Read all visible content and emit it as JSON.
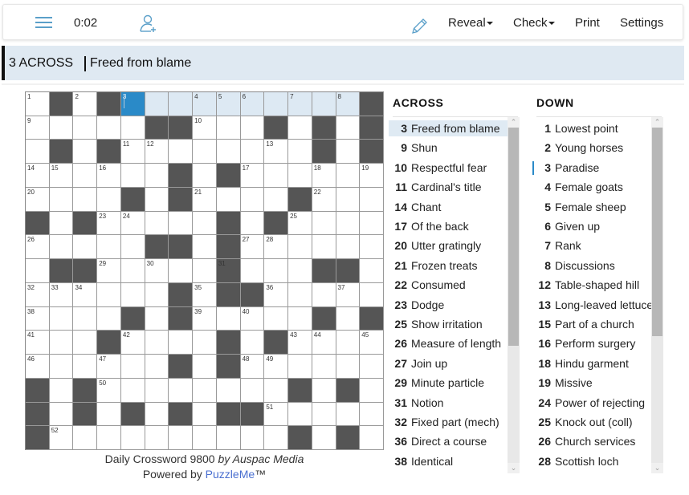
{
  "toolbar": {
    "timer": "0:02",
    "menu_icon": "hamburger-menu-icon",
    "add_user_icon": "add-user-icon",
    "pencil_icon": "pencil-icon",
    "reveal_label": "Reveal",
    "check_label": "Check",
    "print_label": "Print",
    "settings_label": "Settings",
    "accent_color": "#5a9fc9"
  },
  "current_clue": {
    "label": "3 ACROSS",
    "text": "Freed from blame"
  },
  "grid": {
    "size": 15,
    "rows": [
      ".#.#..........#",
      ".....##...#.#.#",
      ".#.#........#.#",
      "......#.#......",
      "....#.#....#...",
      "#.#.....#.#....",
      ".....##.#......",
      ".##.....#...##.",
      "......#.##.....",
      "....#.#.....#.#",
      "...#....#.#....",
      "......#.#......",
      "#.#........#.#.",
      "#.#.#.#.##.....",
      "#..........#.#."
    ],
    "numbers": [
      {
        "r": 0,
        "c": 0,
        "n": "1"
      },
      {
        "r": 0,
        "c": 2,
        "n": "2"
      },
      {
        "r": 0,
        "c": 4,
        "n": "3"
      },
      {
        "r": 0,
        "c": 7,
        "n": "4"
      },
      {
        "r": 0,
        "c": 8,
        "n": "5"
      },
      {
        "r": 0,
        "c": 9,
        "n": "6"
      },
      {
        "r": 0,
        "c": 11,
        "n": "7"
      },
      {
        "r": 0,
        "c": 13,
        "n": "8"
      },
      {
        "r": 1,
        "c": 0,
        "n": "9"
      },
      {
        "r": 1,
        "c": 7,
        "n": "10"
      },
      {
        "r": 2,
        "c": 4,
        "n": "11"
      },
      {
        "r": 2,
        "c": 5,
        "n": "12"
      },
      {
        "r": 2,
        "c": 10,
        "n": "13"
      },
      {
        "r": 3,
        "c": 0,
        "n": "14"
      },
      {
        "r": 3,
        "c": 1,
        "n": "15"
      },
      {
        "r": 3,
        "c": 3,
        "n": "16"
      },
      {
        "r": 3,
        "c": 9,
        "n": "17"
      },
      {
        "r": 3,
        "c": 12,
        "n": "18"
      },
      {
        "r": 3,
        "c": 14,
        "n": "19"
      },
      {
        "r": 4,
        "c": 0,
        "n": "20"
      },
      {
        "r": 4,
        "c": 7,
        "n": "21"
      },
      {
        "r": 4,
        "c": 12,
        "n": "22"
      },
      {
        "r": 5,
        "c": 3,
        "n": "23"
      },
      {
        "r": 5,
        "c": 4,
        "n": "24"
      },
      {
        "r": 5,
        "c": 11,
        "n": "25"
      },
      {
        "r": 6,
        "c": 0,
        "n": "26"
      },
      {
        "r": 6,
        "c": 9,
        "n": "27"
      },
      {
        "r": 6,
        "c": 10,
        "n": "28"
      },
      {
        "r": 7,
        "c": 3,
        "n": "29"
      },
      {
        "r": 7,
        "c": 5,
        "n": "30"
      },
      {
        "r": 7,
        "c": 8,
        "n": "31"
      },
      {
        "r": 8,
        "c": 0,
        "n": "32"
      },
      {
        "r": 8,
        "c": 1,
        "n": "33"
      },
      {
        "r": 8,
        "c": 2,
        "n": "34"
      },
      {
        "r": 8,
        "c": 7,
        "n": "35"
      },
      {
        "r": 8,
        "c": 10,
        "n": "36"
      },
      {
        "r": 8,
        "c": 13,
        "n": "37"
      },
      {
        "r": 9,
        "c": 0,
        "n": "38"
      },
      {
        "r": 9,
        "c": 7,
        "n": "39"
      },
      {
        "r": 9,
        "c": 9,
        "n": "40"
      },
      {
        "r": 10,
        "c": 0,
        "n": "41"
      },
      {
        "r": 10,
        "c": 4,
        "n": "42"
      },
      {
        "r": 10,
        "c": 11,
        "n": "43"
      },
      {
        "r": 10,
        "c": 12,
        "n": "44"
      },
      {
        "r": 10,
        "c": 14,
        "n": "45"
      },
      {
        "r": 11,
        "c": 0,
        "n": "46"
      },
      {
        "r": 11,
        "c": 3,
        "n": "47"
      },
      {
        "r": 11,
        "c": 9,
        "n": "48"
      },
      {
        "r": 11,
        "c": 10,
        "n": "49"
      },
      {
        "r": 12,
        "c": 3,
        "n": "50"
      },
      {
        "r": 13,
        "c": 10,
        "n": "51"
      },
      {
        "r": 14,
        "c": 1,
        "n": "52"
      }
    ],
    "selected": {
      "r": 0,
      "c": 4
    },
    "highlighted_word": {
      "r": 0,
      "c_start": 4,
      "c_end": 13
    },
    "colors": {
      "black": "#555555",
      "selected": "#2a8ac8",
      "highlight": "#dde9f3"
    }
  },
  "credits": {
    "title": "Daily Crossword 9800",
    "by": "by Auspac Media",
    "powered_prefix": "Powered by",
    "powered_link": "PuzzleMe",
    "trademark": "™"
  },
  "across": {
    "heading": "ACROSS",
    "scroll_fraction_visible": 0.45,
    "clues": [
      {
        "n": "3",
        "text": "Freed from blame",
        "active": true
      },
      {
        "n": "9",
        "text": "Shun"
      },
      {
        "n": "10",
        "text": "Respectful fear"
      },
      {
        "n": "11",
        "text": "Cardinal's title"
      },
      {
        "n": "14",
        "text": "Chant"
      },
      {
        "n": "17",
        "text": "Of the back"
      },
      {
        "n": "20",
        "text": "Utter gratingly"
      },
      {
        "n": "21",
        "text": "Frozen treats"
      },
      {
        "n": "22",
        "text": "Consumed"
      },
      {
        "n": "23",
        "text": "Dodge"
      },
      {
        "n": "25",
        "text": "Show irritation"
      },
      {
        "n": "26",
        "text": "Measure of length"
      },
      {
        "n": "27",
        "text": "Join up"
      },
      {
        "n": "29",
        "text": "Minute particle"
      },
      {
        "n": "31",
        "text": "Notion"
      },
      {
        "n": "32",
        "text": "Fixed part (mech)"
      },
      {
        "n": "36",
        "text": "Direct a course"
      },
      {
        "n": "38",
        "text": "Identical"
      }
    ]
  },
  "down": {
    "heading": "DOWN",
    "scroll_fraction_visible": 0.45,
    "clues": [
      {
        "n": "1",
        "text": "Lowest point"
      },
      {
        "n": "2",
        "text": "Young horses"
      },
      {
        "n": "3",
        "text": "Paradise",
        "marked": true
      },
      {
        "n": "4",
        "text": "Female goats"
      },
      {
        "n": "5",
        "text": "Female sheep"
      },
      {
        "n": "6",
        "text": "Given up"
      },
      {
        "n": "7",
        "text": "Rank"
      },
      {
        "n": "8",
        "text": "Discussions"
      },
      {
        "n": "12",
        "text": "Table-shaped hill"
      },
      {
        "n": "13",
        "text": "Long-leaved lettuce"
      },
      {
        "n": "15",
        "text": "Part of a church"
      },
      {
        "n": "16",
        "text": "Perform surgery"
      },
      {
        "n": "18",
        "text": "Hindu garment"
      },
      {
        "n": "19",
        "text": "Missive"
      },
      {
        "n": "24",
        "text": "Power of rejecting"
      },
      {
        "n": "25",
        "text": "Knock out (coll)"
      },
      {
        "n": "26",
        "text": "Church services"
      },
      {
        "n": "28",
        "text": "Scottish loch"
      }
    ]
  }
}
